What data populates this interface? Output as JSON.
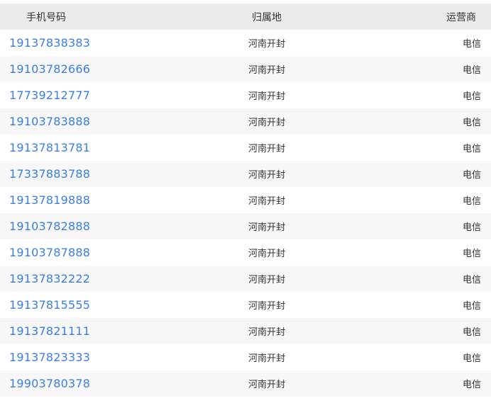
{
  "header": {
    "phone_col": "手机号码",
    "location_col": "归属地",
    "operator_col": "运营商"
  },
  "rows": [
    {
      "phone": "19137838383",
      "location": "河南开封",
      "operator": "电信"
    },
    {
      "phone": "19103782666",
      "location": "河南开封",
      "operator": "电信"
    },
    {
      "phone": "17739212777",
      "location": "河南开封",
      "operator": "电信"
    },
    {
      "phone": "19103783888",
      "location": "河南开封",
      "operator": "电信"
    },
    {
      "phone": "19137813781",
      "location": "河南开封",
      "operator": "电信"
    },
    {
      "phone": "17337883788",
      "location": "河南开封",
      "operator": "电信"
    },
    {
      "phone": "19137819888",
      "location": "河南开封",
      "operator": "电信"
    },
    {
      "phone": "19103782888",
      "location": "河南开封",
      "operator": "电信"
    },
    {
      "phone": "19103787888",
      "location": "河南开封",
      "operator": "电信"
    },
    {
      "phone": "19137832222",
      "location": "河南开封",
      "operator": "电信"
    },
    {
      "phone": "19137815555",
      "location": "河南开封",
      "operator": "电信"
    },
    {
      "phone": "19137821111",
      "location": "河南开封",
      "operator": "电信"
    },
    {
      "phone": "19137823333",
      "location": "河南开封",
      "operator": "电信"
    },
    {
      "phone": "19903780378",
      "location": "河南开封",
      "operator": "电信"
    }
  ],
  "colors": {
    "link": "#3a7fdc",
    "header_bg": "#ebebeb",
    "row_alt_bg": "#f7f7f7",
    "text": "#333333"
  }
}
